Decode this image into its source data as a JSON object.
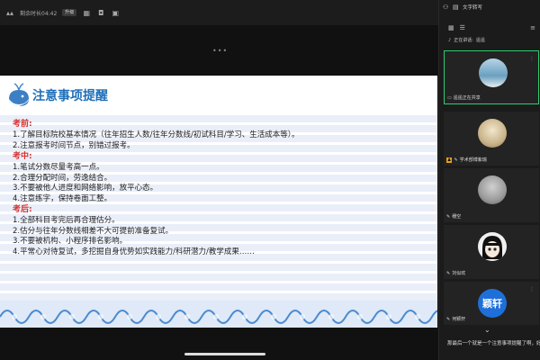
{
  "topbar": {
    "remaining_time": "剩余时长04:42",
    "badge": "升级"
  },
  "slide": {
    "title": "注意事项提醒",
    "sections": [
      {
        "heading": "考前:",
        "lines": [
          "1.了解目标院校基本情况（往年招生人数/往年分数线/初试科目/学习、生活成本等）。",
          "2.注意报考时间节点，别错过报考。"
        ]
      },
      {
        "heading": "考中:",
        "lines": [
          "1.笔试分数尽量考高一点。",
          "2.合理分配时间，劳逸结合。",
          "3.不要被他人进度和网络影响，放平心态。",
          "4.注意练字，保持卷面工整。"
        ]
      },
      {
        "heading": "考后:",
        "lines": [
          "1.全部科目考完后再合理估分。",
          "2.估分与往年分数线相差不大可提前准备复试。",
          "3.不要被机构、小程序排名影响。",
          "4.平常心对待复试，多挖掘自身优势如实践能力/科研潜力/教学成果……"
        ]
      }
    ]
  },
  "panel": {
    "header_title": "文字转写",
    "speaking_label": "正在讲话:",
    "speaking_name": "遥遥",
    "participants": [
      {
        "name": "遥遥正在共享",
        "avatar_color": "#6aa0c0"
      },
      {
        "name": "学术部博紫瑞",
        "avatar_color": "#c9b48a"
      },
      {
        "name": "穗空",
        "avatar_color": "#9a9a9a"
      },
      {
        "name": "刘似欢",
        "avatar_color": "#e8e8e8"
      },
      {
        "name": "何颖轩",
        "avatar_color": "#1e6fd9",
        "avatar_text": "颖轩"
      }
    ],
    "caption": "那最后一个就是一个注意事项提醒了啊，好，我们来看一下前…"
  },
  "colors": {
    "title_blue": "#1e6fb8",
    "heading_red": "#d32f2f",
    "active_green": "#2ecc71"
  }
}
